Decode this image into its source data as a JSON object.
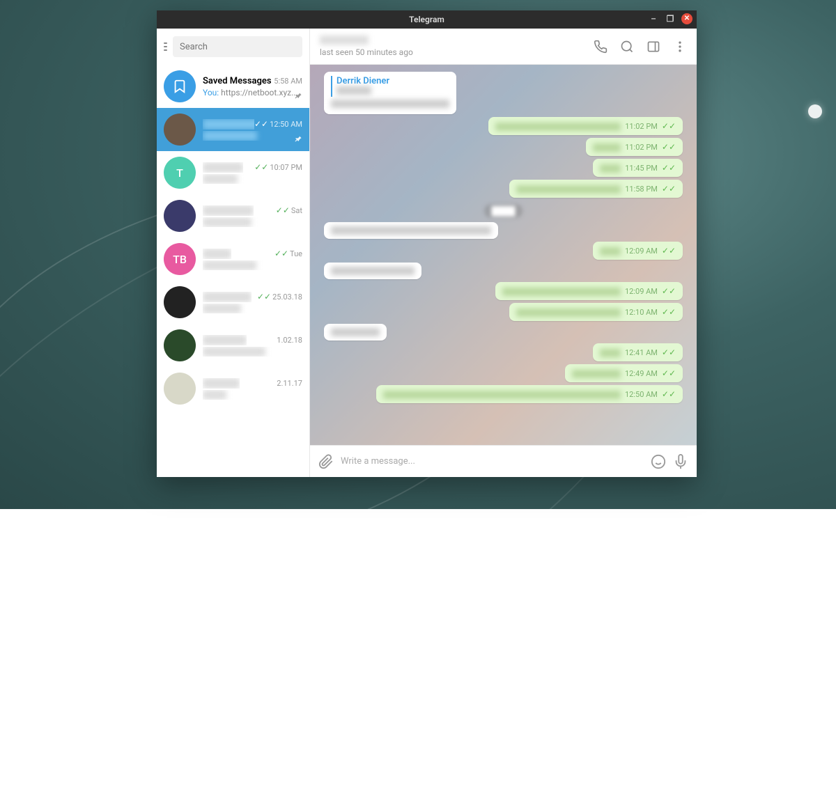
{
  "window": {
    "title": "Telegram"
  },
  "search": {
    "placeholder": "Search"
  },
  "chats": [
    {
      "name": "Saved Messages",
      "time": "5:58 AM",
      "read": false,
      "preview_prefix": "You: ",
      "preview": "https://netboot.xyz...",
      "pinned": true,
      "avatar_type": "bookmark",
      "avatar_bg": "#3a9ee5",
      "active": false
    },
    {
      "name": "██████████",
      "time": "12:50 AM",
      "read": true,
      "preview": "████████",
      "pinned": true,
      "avatar_type": "img",
      "avatar_bg": "#6b5848",
      "active": true
    },
    {
      "name": "███",
      "time": "10:07 PM",
      "read": true,
      "preview": "███",
      "pinned": false,
      "avatar_type": "letter",
      "avatar_letter": "T",
      "avatar_bg": "#4fcfb0",
      "active": false
    },
    {
      "name": "██████",
      "time": "Sat",
      "read": true,
      "preview": "██████",
      "pinned": false,
      "avatar_type": "img",
      "avatar_bg": "#3a3a6a",
      "active": false
    },
    {
      "name": "█████████",
      "time": "Tue",
      "read": true,
      "preview": "██████████████",
      "pinned": false,
      "avatar_type": "letter",
      "avatar_letter": "TB",
      "avatar_bg": "#e85aa0",
      "active": false
    },
    {
      "name": "█████████",
      "time": "25.03.18",
      "read": true,
      "preview": "██████",
      "pinned": false,
      "avatar_type": "img",
      "avatar_bg": "#222",
      "active": false
    },
    {
      "name": "████████████",
      "time": "1.02.18",
      "read": false,
      "preview": "████████",
      "pinned": false,
      "avatar_type": "img",
      "avatar_bg": "#2a4a2a",
      "active": false
    },
    {
      "name": "███████",
      "time": "2.11.17",
      "read": false,
      "preview": "██",
      "pinned": false,
      "avatar_type": "img",
      "avatar_bg": "#d8d8c8",
      "active": false
    }
  ],
  "conversation": {
    "name": "██████",
    "status": "last seen 50 minutes ago",
    "messages": [
      {
        "dir": "in",
        "reply_name": "Derrik Diener",
        "reply_text": "████████",
        "body_w": 170,
        "has_reply": true
      },
      {
        "dir": "out",
        "body_w": 180,
        "time": "11:02 PM"
      },
      {
        "dir": "out",
        "body_w": 40,
        "time": "11:02 PM"
      },
      {
        "dir": "out",
        "body_w": 30,
        "time": "11:45 PM"
      },
      {
        "dir": "out",
        "body_w": 150,
        "time": "11:58 PM"
      },
      {
        "dir": "sep"
      },
      {
        "dir": "in",
        "body_w": 230
      },
      {
        "dir": "out",
        "body_w": 30,
        "time": "12:09 AM"
      },
      {
        "dir": "in",
        "body_w": 120
      },
      {
        "dir": "out",
        "body_w": 170,
        "time": "12:09 AM"
      },
      {
        "dir": "out",
        "body_w": 150,
        "time": "12:10 AM"
      },
      {
        "dir": "in",
        "body_w": 70
      },
      {
        "dir": "out",
        "body_w": 30,
        "time": "12:41 AM"
      },
      {
        "dir": "out",
        "body_w": 70,
        "time": "12:49 AM"
      },
      {
        "dir": "out",
        "body_w": 390,
        "time": "12:50 AM"
      }
    ]
  },
  "composer": {
    "placeholder": "Write a message..."
  }
}
